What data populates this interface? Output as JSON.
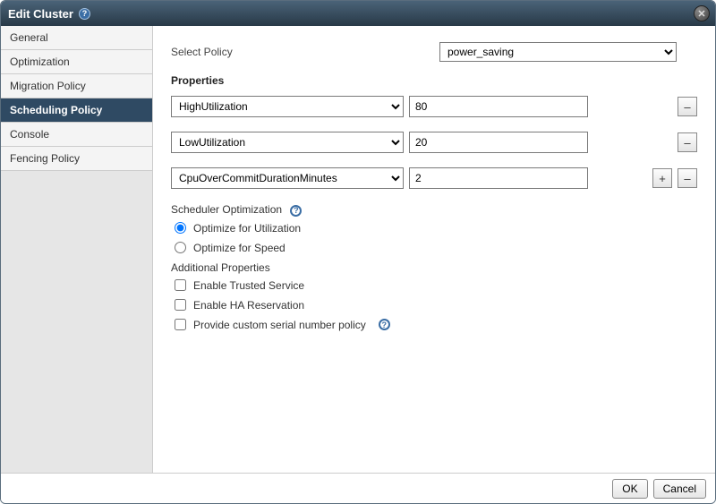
{
  "dialog": {
    "title": "Edit Cluster"
  },
  "sidebar": {
    "tabs": [
      {
        "label": "General"
      },
      {
        "label": "Optimization"
      },
      {
        "label": "Migration Policy"
      },
      {
        "label": "Scheduling Policy"
      },
      {
        "label": "Console"
      },
      {
        "label": "Fencing Policy"
      }
    ],
    "active_index": 3
  },
  "policy": {
    "select_label": "Select Policy",
    "selected": "power_saving"
  },
  "properties": {
    "title": "Properties",
    "rows": [
      {
        "name": "HighUtilization",
        "value": "80",
        "add": false,
        "remove": true
      },
      {
        "name": "LowUtilization",
        "value": "20",
        "add": false,
        "remove": true
      },
      {
        "name": "CpuOverCommitDurationMinutes",
        "value": "2",
        "add": true,
        "remove": true
      }
    ]
  },
  "scheduler": {
    "title": "Scheduler Optimization",
    "options": [
      {
        "label": "Optimize for Utilization",
        "checked": true
      },
      {
        "label": "Optimize for Speed",
        "checked": false
      }
    ]
  },
  "additional": {
    "title": "Additional Properties",
    "items": [
      {
        "label": "Enable Trusted Service",
        "checked": false,
        "help": false
      },
      {
        "label": "Enable HA Reservation",
        "checked": false,
        "help": false
      },
      {
        "label": "Provide custom serial number policy",
        "checked": false,
        "help": true
      }
    ]
  },
  "footer": {
    "ok": "OK",
    "cancel": "Cancel"
  }
}
